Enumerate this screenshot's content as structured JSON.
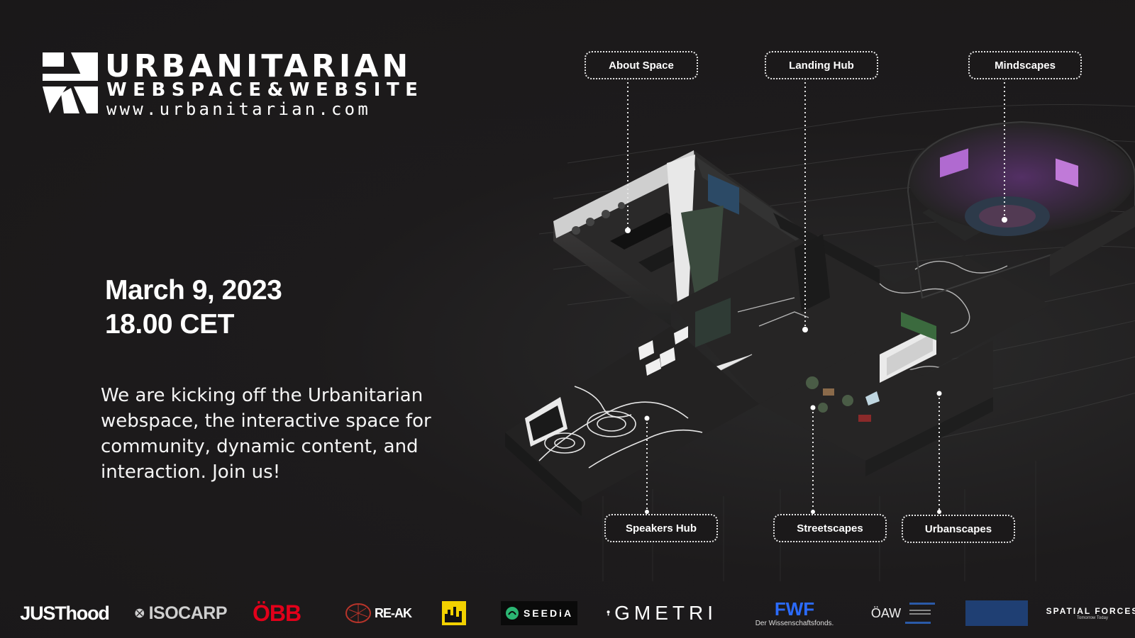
{
  "logo": {
    "title": "URBANITARIAN",
    "subtitle": "WEBSPACE&WEBSITE",
    "url": "www.urbanitarian.com"
  },
  "event": {
    "date": "March 9, 2023",
    "time": "18.00 CET",
    "description": "We are kicking off the Urbanitarian webspace, the interactive space for community, dynamic content, and interaction. Join us!"
  },
  "map": {
    "labels": {
      "about_space": "About Space",
      "landing_hub": "Landing Hub",
      "mindscapes": "Mindscapes",
      "speakers_hub": "Speakers Hub",
      "streetscapes": "Streetscapes",
      "urbanscapes": "Urbanscapes"
    }
  },
  "partners": {
    "justhood": "JUSThood",
    "isocarp": "ISOCARP",
    "obb": "ÖBB",
    "reak": "RE-AK",
    "seedia": "SEEDiA",
    "gmetri": "GMETRI",
    "fwf": "FWF",
    "fwf_sub": "Der Wissenschaftsfonds.",
    "oaw": "ÖAW",
    "spatial_forces": "SPATIAL FORCES",
    "spatial_forces_sub": "Tomorrow Today"
  },
  "colors": {
    "background": "#1d1b1c",
    "text": "#ffffff",
    "obb_red": "#e2001a",
    "fwf_blue": "#2b6bff"
  }
}
